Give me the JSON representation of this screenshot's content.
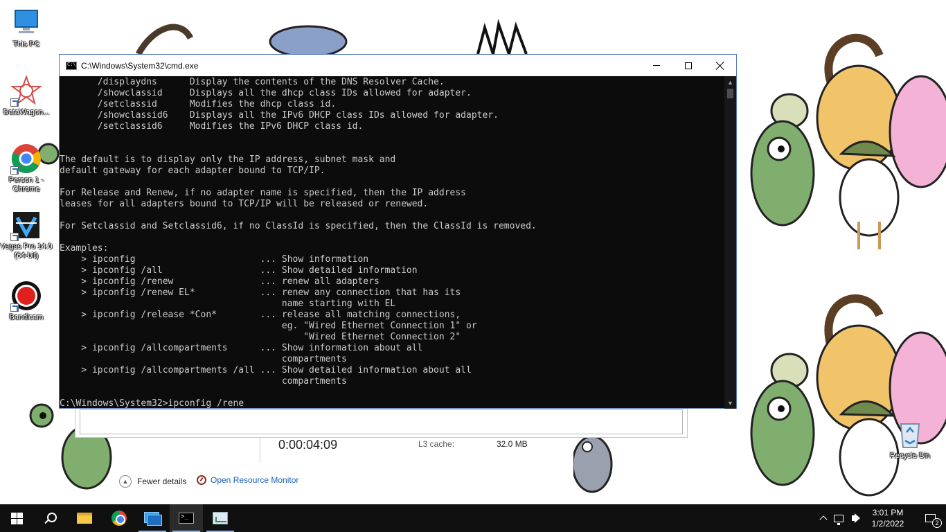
{
  "desktop": {
    "icons": [
      {
        "label": "This PC",
        "icon": "monitor-icon"
      },
      {
        "label": "DataWagon...",
        "icon": "datawagon-icon"
      },
      {
        "label": "Person 1 - Chrome",
        "icon": "chrome-icon"
      },
      {
        "label": "Vegas Pro 14.0 (64-bit)",
        "icon": "vegas-icon"
      },
      {
        "label": "Bandicam",
        "icon": "bandicam-icon"
      },
      {
        "label": "Recycle Bin",
        "icon": "recycle-bin-icon"
      }
    ]
  },
  "cmd": {
    "title": "C:\\Windows\\System32\\cmd.exe",
    "lines": [
      "       /displaydns      Display the contents of the DNS Resolver Cache.",
      "       /showclassid     Displays all the dhcp class IDs allowed for adapter.",
      "       /setclassid      Modifies the dhcp class id.",
      "       /showclassid6    Displays all the IPv6 DHCP class IDs allowed for adapter.",
      "       /setclassid6     Modifies the IPv6 DHCP class id.",
      "",
      "",
      "The default is to display only the IP address, subnet mask and",
      "default gateway for each adapter bound to TCP/IP.",
      "",
      "For Release and Renew, if no adapter name is specified, then the IP address",
      "leases for all adapters bound to TCP/IP will be released or renewed.",
      "",
      "For Setclassid and Setclassid6, if no ClassId is specified, then the ClassId is removed.",
      "",
      "Examples:",
      "    > ipconfig                       ... Show information",
      "    > ipconfig /all                  ... Show detailed information",
      "    > ipconfig /renew                ... renew all adapters",
      "    > ipconfig /renew EL*            ... renew any connection that has its",
      "                                         name starting with EL",
      "    > ipconfig /release *Con*        ... release all matching connections,",
      "                                         eg. \"Wired Ethernet Connection 1\" or",
      "                                             \"Wired Ethernet Connection 2\"",
      "    > ipconfig /allcompartments      ... Show information about all",
      "                                         compartments",
      "    > ipconfig /allcompartments /all ... Show detailed information about all",
      "                                         compartments",
      "",
      "C:\\Windows\\System32>ipconfig /rene"
    ]
  },
  "taskmgr": {
    "uptime": "0:00:04:09",
    "l3_label": "L3 cache:",
    "l3_value": "32.0 MB",
    "fewer_details": "Fewer details",
    "open_resource_monitor": "Open Resource Monitor"
  },
  "taskbar": {
    "time": "3:01 PM",
    "date": "1/2/2022",
    "notification_count": "2"
  },
  "colors": {
    "console_bg": "#0c0c0c",
    "console_text": "#cccccc",
    "taskbar_bg": "#101010",
    "link": "#1a5fb4"
  }
}
